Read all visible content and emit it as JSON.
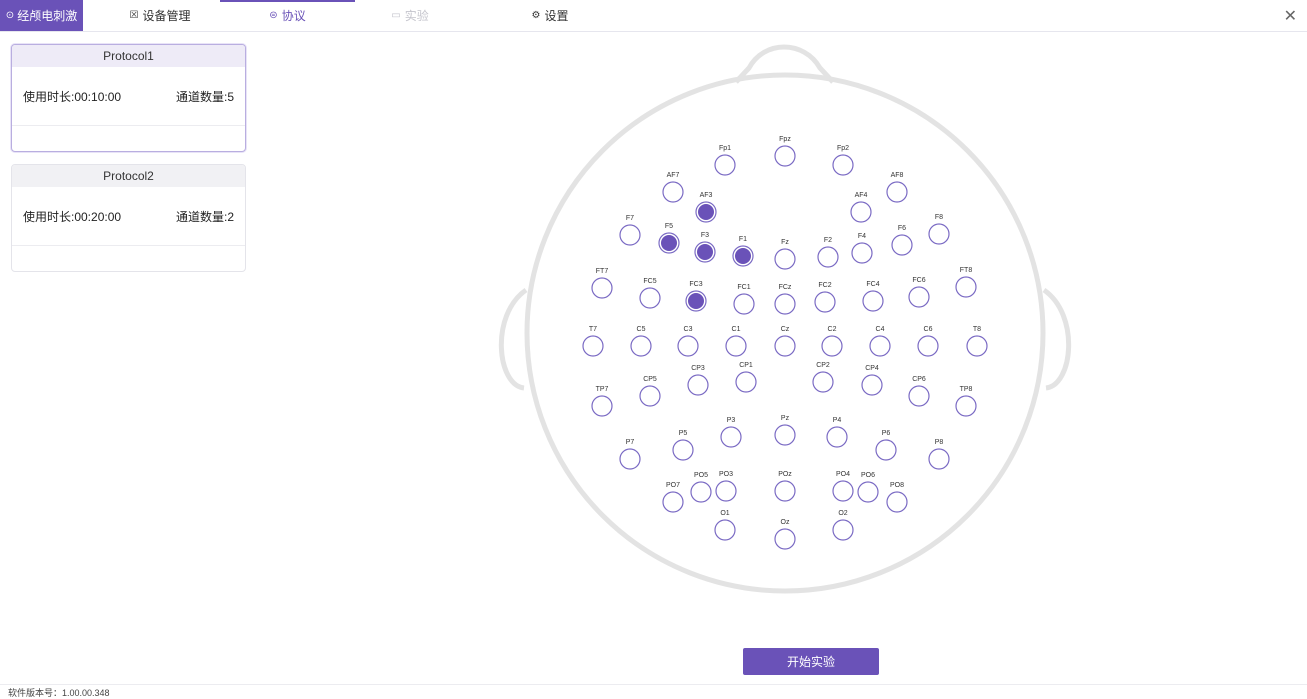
{
  "header": {
    "app_tab": "经颅电刺激",
    "tabs": [
      {
        "label": "设备管理",
        "state": "normal"
      },
      {
        "label": "协议",
        "state": "active"
      },
      {
        "label": "实验",
        "state": "disabled"
      },
      {
        "label": "设置",
        "state": "normal"
      }
    ],
    "close_symbol": "✕"
  },
  "protocols": [
    {
      "name": "Protocol1",
      "duration": "使用时长:00:10:00",
      "channels": "通道数量:5",
      "selected": true
    },
    {
      "name": "Protocol2",
      "duration": "使用时长:00:20:00",
      "channels": "通道数量:2",
      "selected": false
    }
  ],
  "electrodes_active": [
    "AF3",
    "F5",
    "F3",
    "F1",
    "FC3"
  ],
  "electrode_labels": [
    "Fp1",
    "Fpz",
    "Fp2",
    "AF7",
    "AF3",
    "AF4",
    "AF8",
    "F7",
    "F5",
    "F3",
    "F1",
    "Fz",
    "F2",
    "F4",
    "F6",
    "F8",
    "FT7",
    "FC5",
    "FC3",
    "FC1",
    "FCz",
    "FC2",
    "FC4",
    "FC6",
    "FT8",
    "T7",
    "C5",
    "C3",
    "C1",
    "Cz",
    "C2",
    "C4",
    "C6",
    "T8",
    "TP7",
    "CP5",
    "CP3",
    "CP1",
    "CP2",
    "CP4",
    "CP6",
    "TP8",
    "P7",
    "P5",
    "P3",
    "Pz",
    "P4",
    "P6",
    "P8",
    "PO7",
    "PO5",
    "PO3",
    "POz",
    "PO4",
    "PO6",
    "PO8",
    "O1",
    "Oz",
    "O2"
  ],
  "start_button": "开始实验",
  "version": "软件版本号：1.00.00.348",
  "colors": {
    "accent": "#6a52b8",
    "electrode_fill": "#6a52b8",
    "electrode_stroke": "#7b6bc4",
    "head": "#e3e3e3"
  },
  "icons": {
    "app": "circle-dot-icon",
    "device": "device-icon",
    "protocol": "layers-icon",
    "experiment": "monitor-icon",
    "settings": "gear-icon"
  }
}
